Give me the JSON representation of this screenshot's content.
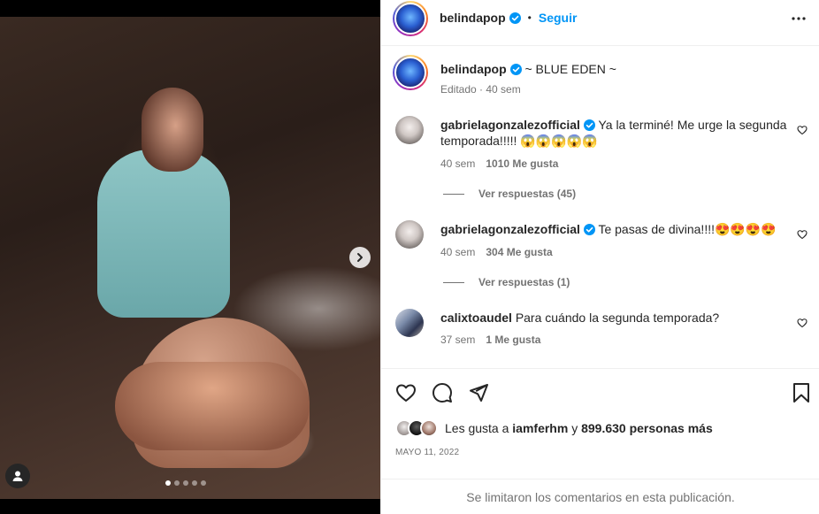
{
  "media": {
    "carousel_count": 5,
    "carousel_active_index": 0
  },
  "header": {
    "username": "belindapop",
    "separator": "•",
    "follow_label": "Seguir",
    "more_icon": "more-horizontal-icon"
  },
  "caption": {
    "username": "belindapop",
    "text": "~ BLUE EDEN ~",
    "meta": "Editado · 40 sem"
  },
  "comments": [
    {
      "username": "gabrielagonzalezofficial",
      "text": "Ya la terminé! Me urge la segunda temporada!!!!! 😱😱😱😱😱",
      "time": "40 sem",
      "likes": "1010 Me gusta",
      "replies": "Ver respuestas (45)"
    },
    {
      "username": "gabrielagonzalezofficial",
      "text": "Te pasas de divina!!!!😍😍😍😍",
      "time": "40 sem",
      "likes": "304 Me gusta",
      "replies": "Ver respuestas (1)"
    },
    {
      "username": "calixtoaudel",
      "text": "Para cuándo la segunda temporada?",
      "time": "37 sem",
      "likes": "1 Me gusta"
    }
  ],
  "likes": {
    "prefix": "Les gusta a",
    "user": "iamferhm",
    "connector": "y",
    "count": "899.630 personas más"
  },
  "date": "MAYO 11, 2022",
  "comments_limited": "Se limitaron los comentarios en esta publicación.",
  "colors": {
    "blue": "#0095f6",
    "text": "#262626",
    "muted": "#737373",
    "border": "#efefef"
  }
}
